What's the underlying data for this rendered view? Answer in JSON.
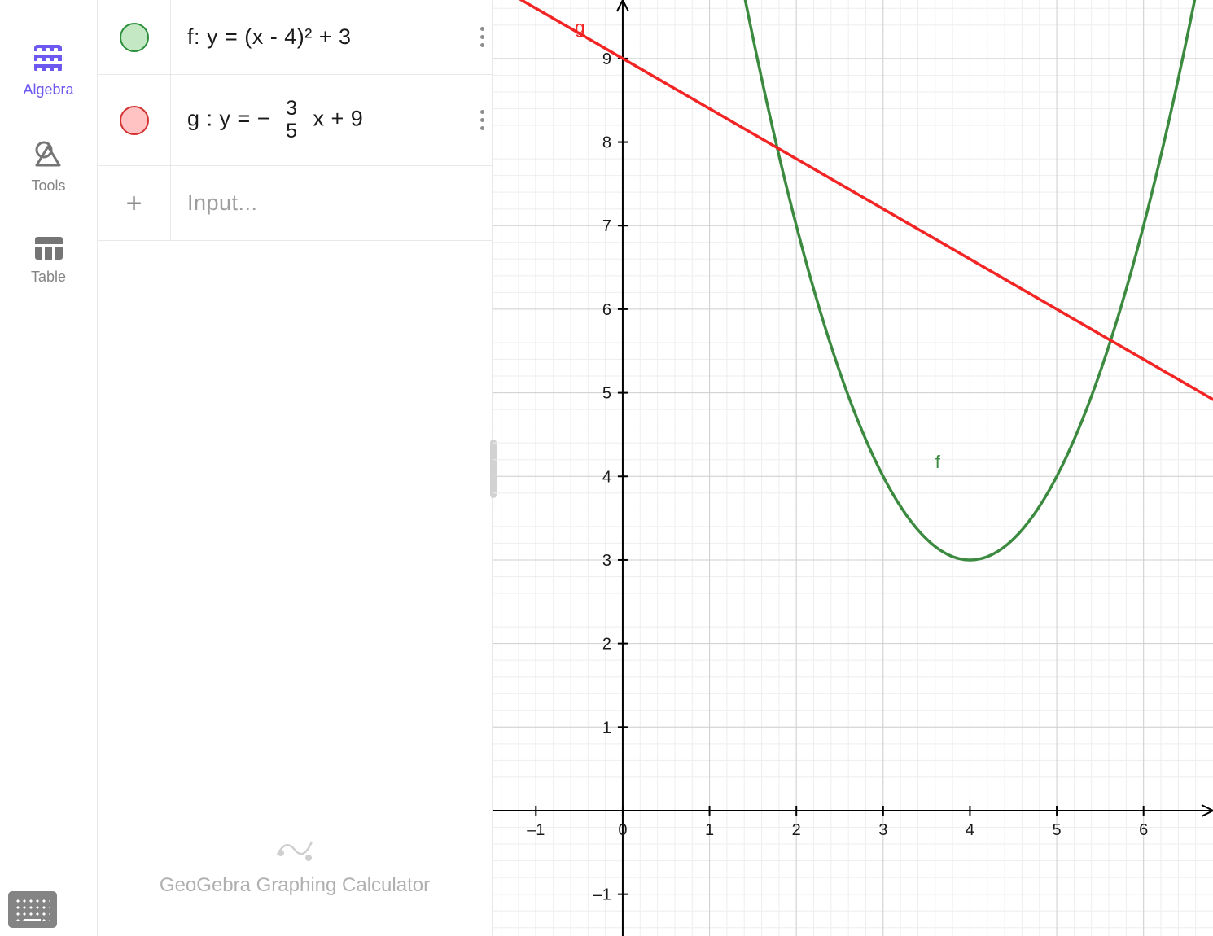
{
  "sidebar": {
    "tabs": [
      {
        "id": "algebra",
        "label": "Algebra",
        "active": true
      },
      {
        "id": "tools",
        "label": "Tools",
        "active": false
      },
      {
        "id": "table",
        "label": "Table",
        "active": false
      }
    ]
  },
  "rows": [
    {
      "name": "f",
      "color_fill": "#c4e7c4",
      "color_stroke": "#2a8f3b",
      "expr_display": "f: y = (x - 4)² + 3"
    },
    {
      "name": "g",
      "color_fill": "#ffc3c3",
      "color_stroke": "#d33030",
      "expr_display": "g : y = − (3/5) x + 9",
      "frac_num": "3",
      "frac_den": "5",
      "prefix": "g : y = − ",
      "suffix": " x + 9"
    }
  ],
  "input_placeholder": "Input...",
  "footer_text": "GeoGebra Graphing Calculator",
  "chart_data": {
    "type": "line",
    "x_range": [
      -1.5,
      6.8
    ],
    "y_range": [
      -1.5,
      9.7
    ],
    "x_ticks": [
      -1,
      0,
      1,
      2,
      3,
      4,
      5,
      6
    ],
    "y_ticks": [
      -1,
      1,
      2,
      3,
      4,
      5,
      6,
      7,
      8,
      9
    ],
    "minor_grid_step": 0.2,
    "major_grid_step": 1,
    "series": [
      {
        "name": "f",
        "label": "f",
        "color": "#3b8a3f",
        "type": "parabola",
        "formula": "y = (x - 4)^2 + 3",
        "vertex": [
          4,
          3
        ],
        "label_pos": [
          3.6,
          4.1
        ]
      },
      {
        "name": "g",
        "label": "g",
        "color": "#f22424",
        "type": "line",
        "formula": "y = -3/5 x + 9",
        "slope": -0.6,
        "intercept": 9,
        "label_pos": [
          -0.55,
          9.3
        ]
      }
    ]
  }
}
